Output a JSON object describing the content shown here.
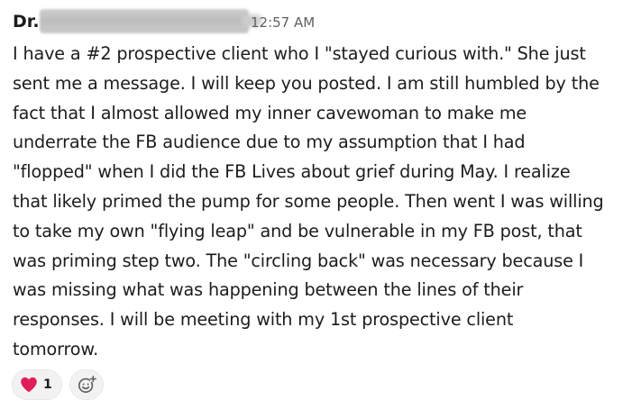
{
  "message": {
    "author_prefix": "Dr.",
    "timestamp": "12:57 AM",
    "body_lines": [
      "I have a #2 prospective client who I \"stayed curious with.\" She just",
      "sent me a message. I will keep you posted. I am still humbled by the",
      "fact that I almost allowed my inner cavewoman to make me",
      "underrate the FB audience due to my assumption that I had",
      "\"flopped\" when I did the FB Lives about grief during May.  I realize",
      "that likely primed the pump for some people. Then went I was willing",
      "to take my own \"flying leap\" and be vulnerable in my FB post,  that",
      "was priming step two. The \"circling back\" was necessary because I",
      "was missing what was happening between the lines of their",
      "responses.  I will be meeting with my 1st prospective client",
      "tomorrow."
    ]
  },
  "reactions": [
    {
      "icon": "heart-icon",
      "count": "1",
      "color": "#e01e5a"
    }
  ],
  "add_reaction": {
    "icon": "add-reaction-icon"
  },
  "colors": {
    "text": "#1d1c1d",
    "timestamp": "#616061",
    "pill_background": "#f2f2f3"
  }
}
